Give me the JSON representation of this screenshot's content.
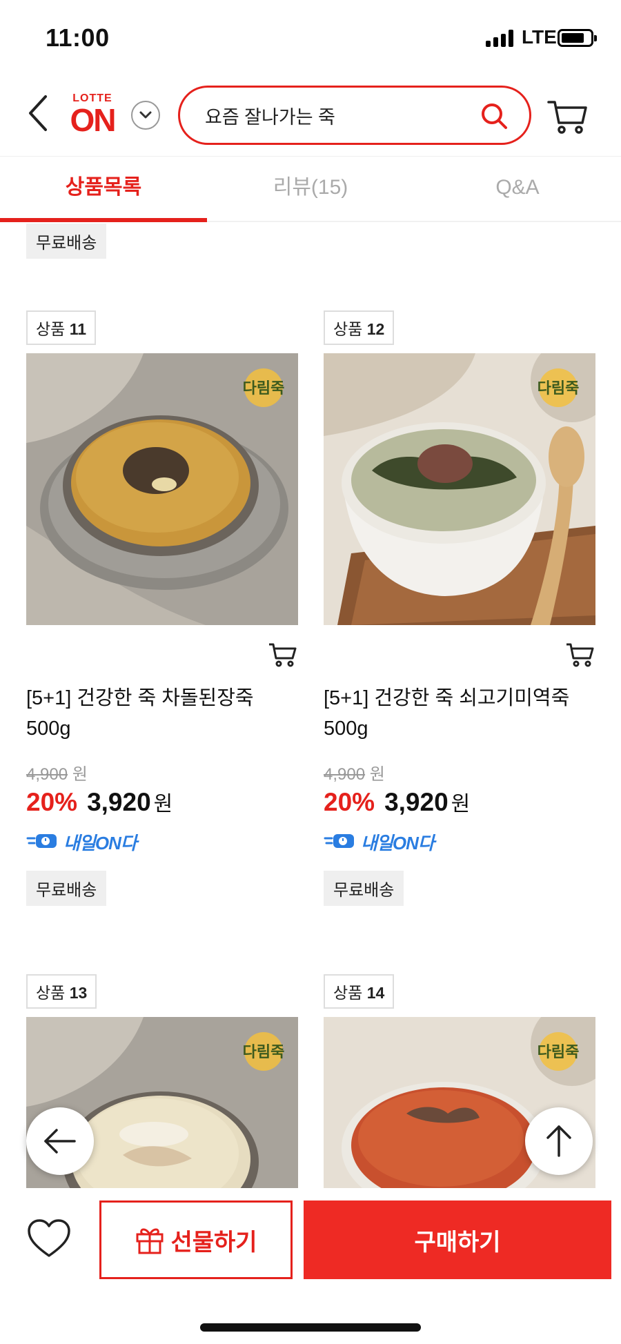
{
  "status_bar": {
    "time": "11:00",
    "network": "LTE"
  },
  "header": {
    "logo_top": "LOTTE",
    "logo_main": "ON",
    "search_value": "요즘 잘나가는 죽"
  },
  "tabs": [
    {
      "label": "상품목록",
      "active": true
    },
    {
      "label": "리뷰(15)",
      "active": false
    },
    {
      "label": "Q&A",
      "active": false
    }
  ],
  "top_free_shipping": "무료배송",
  "products": [
    {
      "label_prefix": "상품",
      "number": "11",
      "name": "[5+1] 건강한 죽 차돌된장죽 500g",
      "original_price": "4,900",
      "original_unit": "원",
      "discount_rate": "20%",
      "price": "3,920",
      "price_unit": "원",
      "delivery": "내일ON다",
      "shipping": "무료배송",
      "brand_mark": "다림죽"
    },
    {
      "label_prefix": "상품",
      "number": "12",
      "name": "[5+1] 건강한 죽 쇠고기미역죽 500g",
      "original_price": "4,900",
      "original_unit": "원",
      "discount_rate": "20%",
      "price": "3,920",
      "price_unit": "원",
      "delivery": "내일ON다",
      "shipping": "무료배송",
      "brand_mark": "다림죽"
    },
    {
      "label_prefix": "상품",
      "number": "13",
      "brand_mark": "다림죽"
    },
    {
      "label_prefix": "상품",
      "number": "14",
      "brand_mark": "다림죽"
    }
  ],
  "bottom_bar": {
    "gift_label": "선물하기",
    "buy_label": "구매하기"
  },
  "colors": {
    "brand": "#e5211c",
    "delivery": "#2a7de1",
    "buy_button": "#ee2a24"
  },
  "icons": [
    "back-icon",
    "chevron-down-icon",
    "search-icon",
    "cart-icon",
    "add-to-cart-icon",
    "delivery-truck-icon",
    "arrow-left-icon",
    "arrow-up-icon",
    "heart-icon",
    "gift-icon"
  ]
}
